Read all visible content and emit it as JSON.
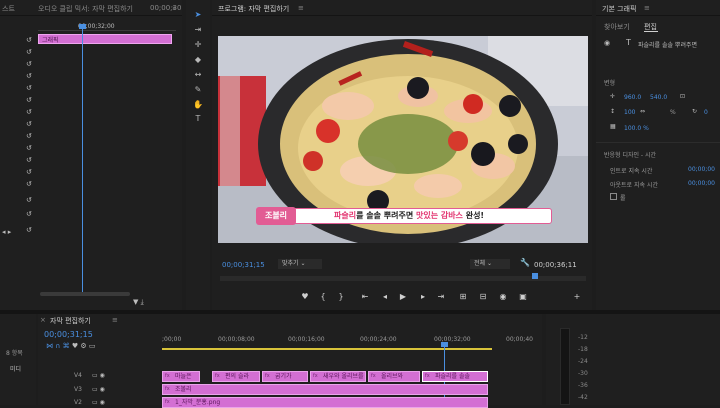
{
  "left_panel": {
    "tab_partial": "스트",
    "tab_audio_mixer": "오디오 클립 믹서: 자막 편집하기",
    "tab_source_tc": "00;00;30",
    "ruler_time": "00;00;32;00",
    "clip_label": "그래픽"
  },
  "tools": [
    "selection",
    "track-select",
    "ripple",
    "razor",
    "slip",
    "pen",
    "hand",
    "type"
  ],
  "program_monitor": {
    "title": "프로그램: 자막 편집하기",
    "menu_icon": "≡",
    "current_tc": "00;00;31;15",
    "fit_label": "맞추기",
    "quality_label": "전체",
    "duration_tc": "00;00;36;11",
    "subtitle_tag": "조볼리",
    "subtitle_parts": [
      {
        "text": "파슬리",
        "color": "#e2336f"
      },
      {
        "text": "를 솔솔 뿌려주면 ",
        "color": "#222222"
      },
      {
        "text": "맛있는 감바스",
        "color": "#e2336f"
      },
      {
        "text": " 완성!",
        "color": "#222222"
      }
    ],
    "controls": [
      "marker",
      "in",
      "out",
      "goto-in",
      "step-back",
      "play",
      "step-forward",
      "goto-out",
      "insert",
      "overwrite",
      "export-frame",
      "camera",
      "add"
    ]
  },
  "essential_graphics": {
    "title": "기본 그래픽",
    "tab_browse": "찾아보기",
    "tab_edit": "편집",
    "layer_name": "파슬리를 솔솔 뿌려주면",
    "section_align": "맞춤",
    "section_transform": "변형",
    "pos_x": "960.0",
    "pos_y": "540.0",
    "scale": "100",
    "scale_unit": "%",
    "opacity": "100.0 %",
    "rotation": "0",
    "responsive_design": "반응형 디자인 - 시간",
    "intro_label": "인트로 지속 시간",
    "intro_value": "00;00;00",
    "outro_label": "아웃트로 지속 시간",
    "outro_value": "00;00;00",
    "roll_label": "롤"
  },
  "timeline": {
    "title": "자막 편집하기",
    "timecode": "00;00;31;15",
    "ruler": [
      ";00;00",
      "00;00;08;00",
      "00;00;16;00",
      "00;00;24;00",
      "00;00;32;00",
      "00;00;40"
    ],
    "tracks": [
      "V4",
      "V3",
      "V2"
    ],
    "clips_v4": [
      "마늘은",
      "편의 슬라",
      "굽기가",
      "새우와 올리브를",
      "올리브와",
      "파슬리를 솔솔"
    ],
    "clip_v3": "조볼리",
    "clip_v2": "1_자막_분홍.png",
    "project_items": "8 항목",
    "project_media": "미디"
  },
  "audio_meter": {
    "labels": [
      "-12",
      "-18",
      "-24",
      "-30",
      "-36",
      "-42"
    ]
  }
}
